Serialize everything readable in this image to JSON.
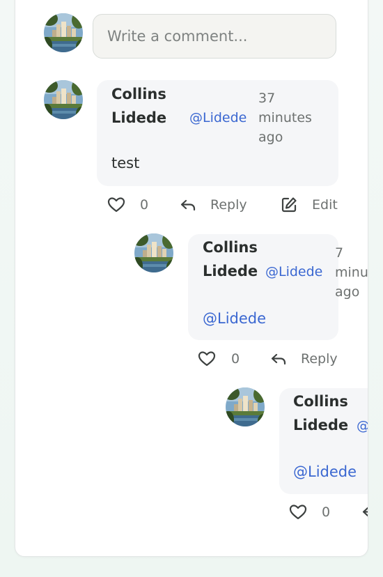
{
  "composer": {
    "placeholder": "Write a comment..."
  },
  "comments": [
    {
      "author": "Collins Lidede",
      "handle": "@Lidede",
      "time": "37 minutes ago",
      "body": "test",
      "likes": "0",
      "reply_label": "Reply",
      "edit_label": "Edit"
    },
    {
      "author": "Collins Lidede",
      "handle": "@Lidede",
      "time": "7 minu ago",
      "time_line1": "7",
      "time_line2": "minu",
      "time_line3": "ago",
      "body": "@Lidede",
      "likes": "0",
      "reply_label": "Reply"
    },
    {
      "author": "Collins Lidede",
      "handle": "@",
      "body": "@Lidede",
      "likes": "0"
    }
  ],
  "colors": {
    "mention": "#3a67d1",
    "bubble": "#f5f6f8",
    "muted": "#6d7170"
  },
  "icons": [
    "avatar-city-icon",
    "heart-icon",
    "reply-arrow-icon",
    "edit-pencil-icon"
  ]
}
